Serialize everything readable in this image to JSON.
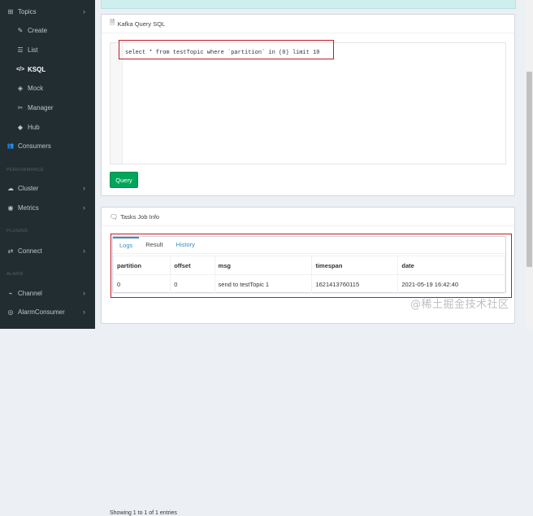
{
  "sidebar": {
    "items": [
      {
        "label": "Topics",
        "icon": "topics-icon",
        "glyph": "⊞",
        "chevron": true,
        "sub": false,
        "active": false
      },
      {
        "label": "Create",
        "icon": "edit-icon",
        "glyph": "✎",
        "chevron": false,
        "sub": true,
        "active": false
      },
      {
        "label": "List",
        "icon": "list-icon",
        "glyph": "☰",
        "chevron": false,
        "sub": true,
        "active": false
      },
      {
        "label": "KSQL",
        "icon": "code-icon",
        "glyph": "</>",
        "chevron": false,
        "sub": true,
        "active": true
      },
      {
        "label": "Mock",
        "icon": "mock-icon",
        "glyph": "◈",
        "chevron": false,
        "sub": true,
        "active": false
      },
      {
        "label": "Manager",
        "icon": "manager-icon",
        "glyph": "✂",
        "chevron": false,
        "sub": true,
        "active": false
      },
      {
        "label": "Hub",
        "icon": "hub-icon",
        "glyph": "◆",
        "chevron": false,
        "sub": true,
        "active": false
      },
      {
        "label": "Consumers",
        "icon": "users-icon",
        "glyph": "👥",
        "chevron": false,
        "sub": false,
        "active": false
      }
    ],
    "sections": {
      "performance": "PERFORMANCE",
      "plugins": "PLUGINS",
      "alarm": "ALARM"
    },
    "performance_items": [
      {
        "label": "Cluster",
        "icon": "cloud-icon",
        "glyph": "☁"
      },
      {
        "label": "Metrics",
        "icon": "eye-icon",
        "glyph": "◉"
      }
    ],
    "plugin_items": [
      {
        "label": "Connect",
        "icon": "connect-icon",
        "glyph": "⇄"
      }
    ],
    "alarm_items": [
      {
        "label": "Channel",
        "icon": "channel-icon",
        "glyph": "⌁"
      },
      {
        "label": "AlarmConsumer",
        "icon": "alarm-icon",
        "glyph": "◎"
      }
    ]
  },
  "query_box": {
    "title": "Kafka Query SQL",
    "sql": "select * from testTopic where `partition` in (0) limit 10",
    "button_label": "Query"
  },
  "tasks_box": {
    "title": "Tasks Job Info",
    "tabs": [
      "Logs",
      "Result",
      "History"
    ],
    "columns": [
      "partition",
      "offset",
      "msg",
      "timespan",
      "date"
    ],
    "rows": [
      [
        "0",
        "0",
        "send to testTopic 1",
        "1621413760115",
        "2021-05-19 16:42:40"
      ]
    ],
    "entries": "Showing 1 to 1 of 1 entries"
  },
  "watermark": "@稀土掘金技术社区",
  "colors": {
    "sidebar_bg": "#222d32",
    "accent": "#3c8dbc",
    "success": "#00a65a",
    "highlight": "#c21a26"
  }
}
